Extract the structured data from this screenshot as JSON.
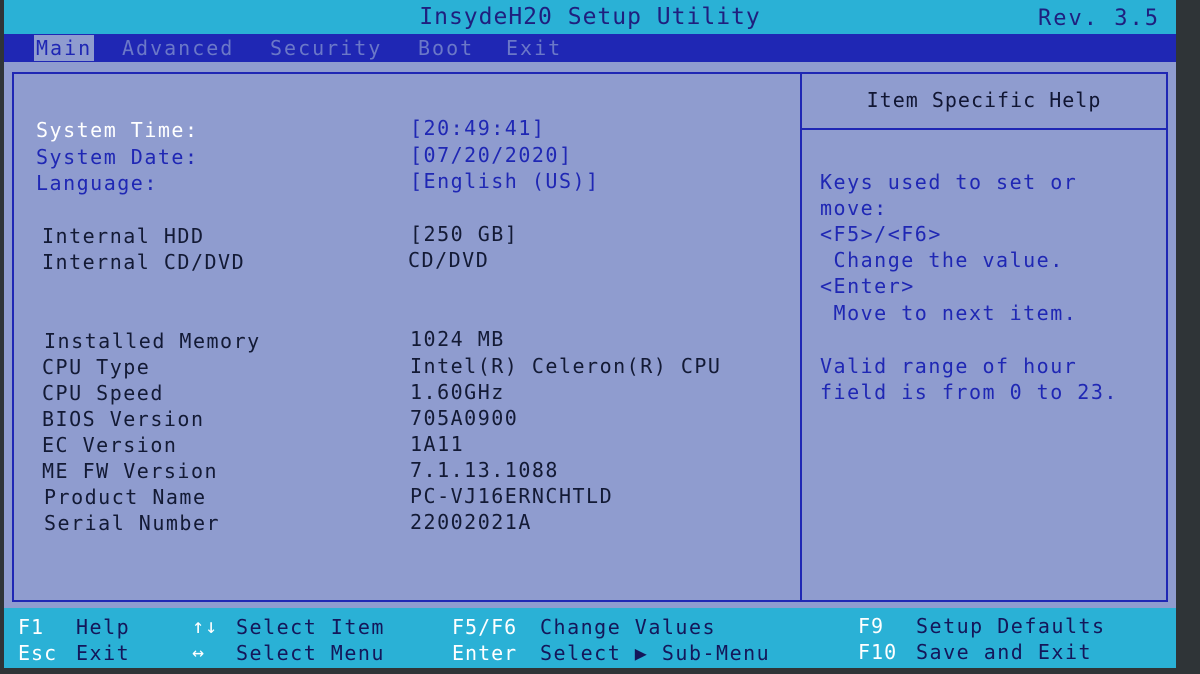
{
  "header": {
    "title": "InsydeH20 Setup Utility",
    "revision": "Rev. 3.5"
  },
  "menu": {
    "items": [
      {
        "label": "Main",
        "active": true
      },
      {
        "label": "Advanced",
        "active": false
      },
      {
        "label": "Security",
        "active": false
      },
      {
        "label": "Boot",
        "active": false
      },
      {
        "label": "Exit",
        "active": false
      }
    ]
  },
  "main": {
    "system_time": {
      "label": "System Time:",
      "value": "[20:49:41]"
    },
    "system_date": {
      "label": "System Date:",
      "value": "[07/20/2020]"
    },
    "language": {
      "label": "Language:",
      "value": "[English (US)]"
    },
    "internal_hdd": {
      "label": "Internal HDD",
      "value": "[250 GB]"
    },
    "internal_cd_dvd": {
      "label": "Internal CD/DVD",
      "value": "CD/DVD"
    },
    "installed_memory": {
      "label": "Installed Memory",
      "value": "1024 MB"
    },
    "cpu_type": {
      "label": "CPU Type",
      "value": "Intel(R) Celeron(R) CPU"
    },
    "cpu_speed": {
      "label": "CPU Speed",
      "value": "1.60GHz"
    },
    "bios_version": {
      "label": "BIOS Version",
      "value": "705A0900"
    },
    "ec_version": {
      "label": "EC Version",
      "value": "1A11"
    },
    "me_fw_version": {
      "label": "ME FW Version",
      "value": "7.1.13.1088"
    },
    "product_name": {
      "label": "Product Name",
      "value": "PC-VJ16ERNCHTLD"
    },
    "serial_number": {
      "label": "Serial Number",
      "value": "22002021A"
    }
  },
  "help": {
    "title": "Item Specific Help",
    "lines": [
      "Keys used to set or",
      "move:",
      "<F5>/<F6>",
      " Change the value.",
      "<Enter>",
      " Move to next item.",
      "Valid range of hour",
      "field is from 0 to 23."
    ]
  },
  "footer": {
    "f1_key": "F1",
    "f1_desc": "Help",
    "esc_key": "Esc",
    "esc_desc": "Exit",
    "updown_key": "↑↓",
    "updown_desc": "Select Item",
    "leftright_key": "↔",
    "leftright_desc": "Select Menu",
    "f5f6_key": "F5/F6",
    "f5f6_desc": "Change Values",
    "enter_key": "Enter",
    "enter_desc": "Select ▶ Sub-Menu",
    "f9_key": "F9",
    "f9_desc": "Setup Defaults",
    "f10_key": "F10",
    "f10_desc": "Save and Exit"
  },
  "colors": {
    "background": "#8f9ccf",
    "title_bar": "#2ab1d6",
    "menu_bar": "#1f27b4",
    "accent_blue": "#1f27b4",
    "selected_text": "#ffffff"
  }
}
